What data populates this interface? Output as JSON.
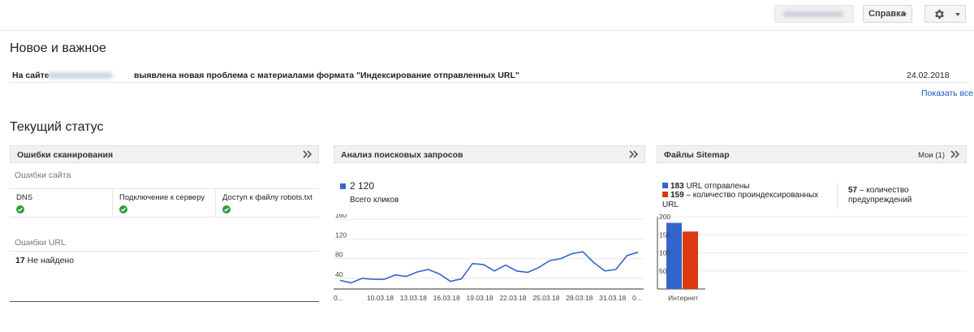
{
  "topbar": {
    "help_label": "Справка",
    "icons": {
      "settings": "gear-icon",
      "help_caret": "caret-down-icon"
    }
  },
  "whats_new": {
    "title": "Новое и важное",
    "notice_prefix": "На сайте",
    "notice_text": "выявлена новая проблема с материалами формата \"Индексирование отправленных URL\"",
    "notice_date": "24.02.2018",
    "show_all": "Показать все"
  },
  "current_status": {
    "title": "Текущий статус"
  },
  "crawl_errors": {
    "title": "Ошибки сканирования",
    "site_errors_label": "Ошибки сайта",
    "columns": [
      {
        "label": "DNS",
        "status": "ok"
      },
      {
        "label": "Подключение к серверу",
        "status": "ok"
      },
      {
        "label": "Доступ к файлу robots.txt",
        "status": "ok"
      }
    ],
    "url_errors_label": "Ошибки URL",
    "url_errors_count": "17",
    "url_errors_text": "Не найдено"
  },
  "search_analytics": {
    "title": "Анализ поисковых запросов",
    "total_clicks_value": "2 120",
    "total_clicks_label": "Всего кликов",
    "series_color": "#3366cc"
  },
  "sitemaps": {
    "title": "Файлы Sitemap",
    "mine_label": "Мои (1)",
    "submitted_count": "183",
    "submitted_text": "URL отправлены",
    "indexed_count": "159",
    "indexed_text": "– количество проиндексированных URL",
    "warnings_count": "57",
    "warnings_text": "– количество предупреждений",
    "submitted_color": "#3366cc",
    "indexed_color": "#dc3912"
  },
  "chart_data": [
    {
      "type": "line",
      "title": "",
      "x_ticks": [
        "0...",
        "10.03.18",
        "13.03.18",
        "16.03.18",
        "19.03.18",
        "22.03.18",
        "25.03.18",
        "28.03.18",
        "31.03.18",
        "0..."
      ],
      "y_ticks": [
        40,
        80,
        120,
        160
      ],
      "ylim": [
        30,
        165
      ],
      "series": [
        {
          "values": [
            36,
            31,
            40,
            38,
            38,
            47,
            44,
            53,
            58,
            49,
            34,
            39,
            70,
            68,
            55,
            67,
            55,
            52,
            62,
            76,
            80,
            90,
            94,
            72,
            55,
            58,
            86,
            93
          ]
        }
      ],
      "grid": true
    },
    {
      "type": "bar",
      "title": "",
      "categories": [
        "Интернет"
      ],
      "y_ticks": [
        50,
        100,
        150,
        200
      ],
      "ylim": [
        0,
        200
      ],
      "series": [
        {
          "name": "URL отправлены",
          "values": [
            183
          ]
        },
        {
          "name": "количество проиндексированных URL",
          "values": [
            159
          ]
        }
      ],
      "grid": true
    }
  ]
}
